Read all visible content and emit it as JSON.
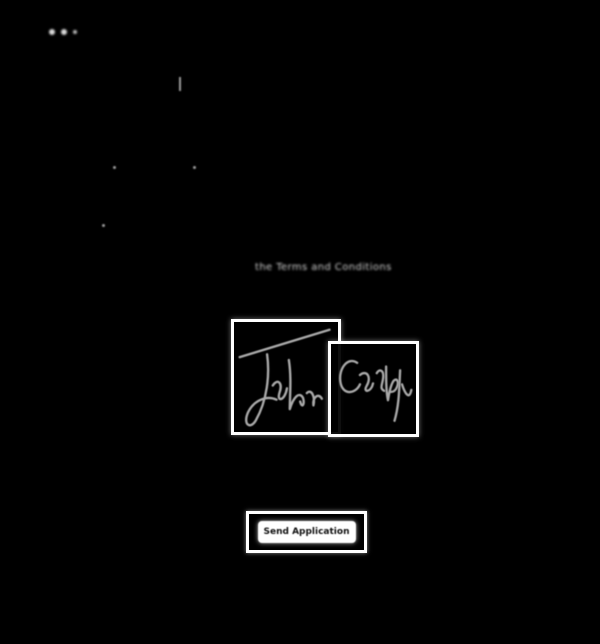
{
  "screen": {
    "top_indicator_icons": [
      "status-dot-icon",
      "status-dot-icon",
      "status-dot-icon"
    ],
    "center_label": "the Terms and Conditions",
    "submit_button_label": "Send Application",
    "signature_icons": [
      "john-signature-icon",
      "crosby-signature-icon"
    ]
  }
}
